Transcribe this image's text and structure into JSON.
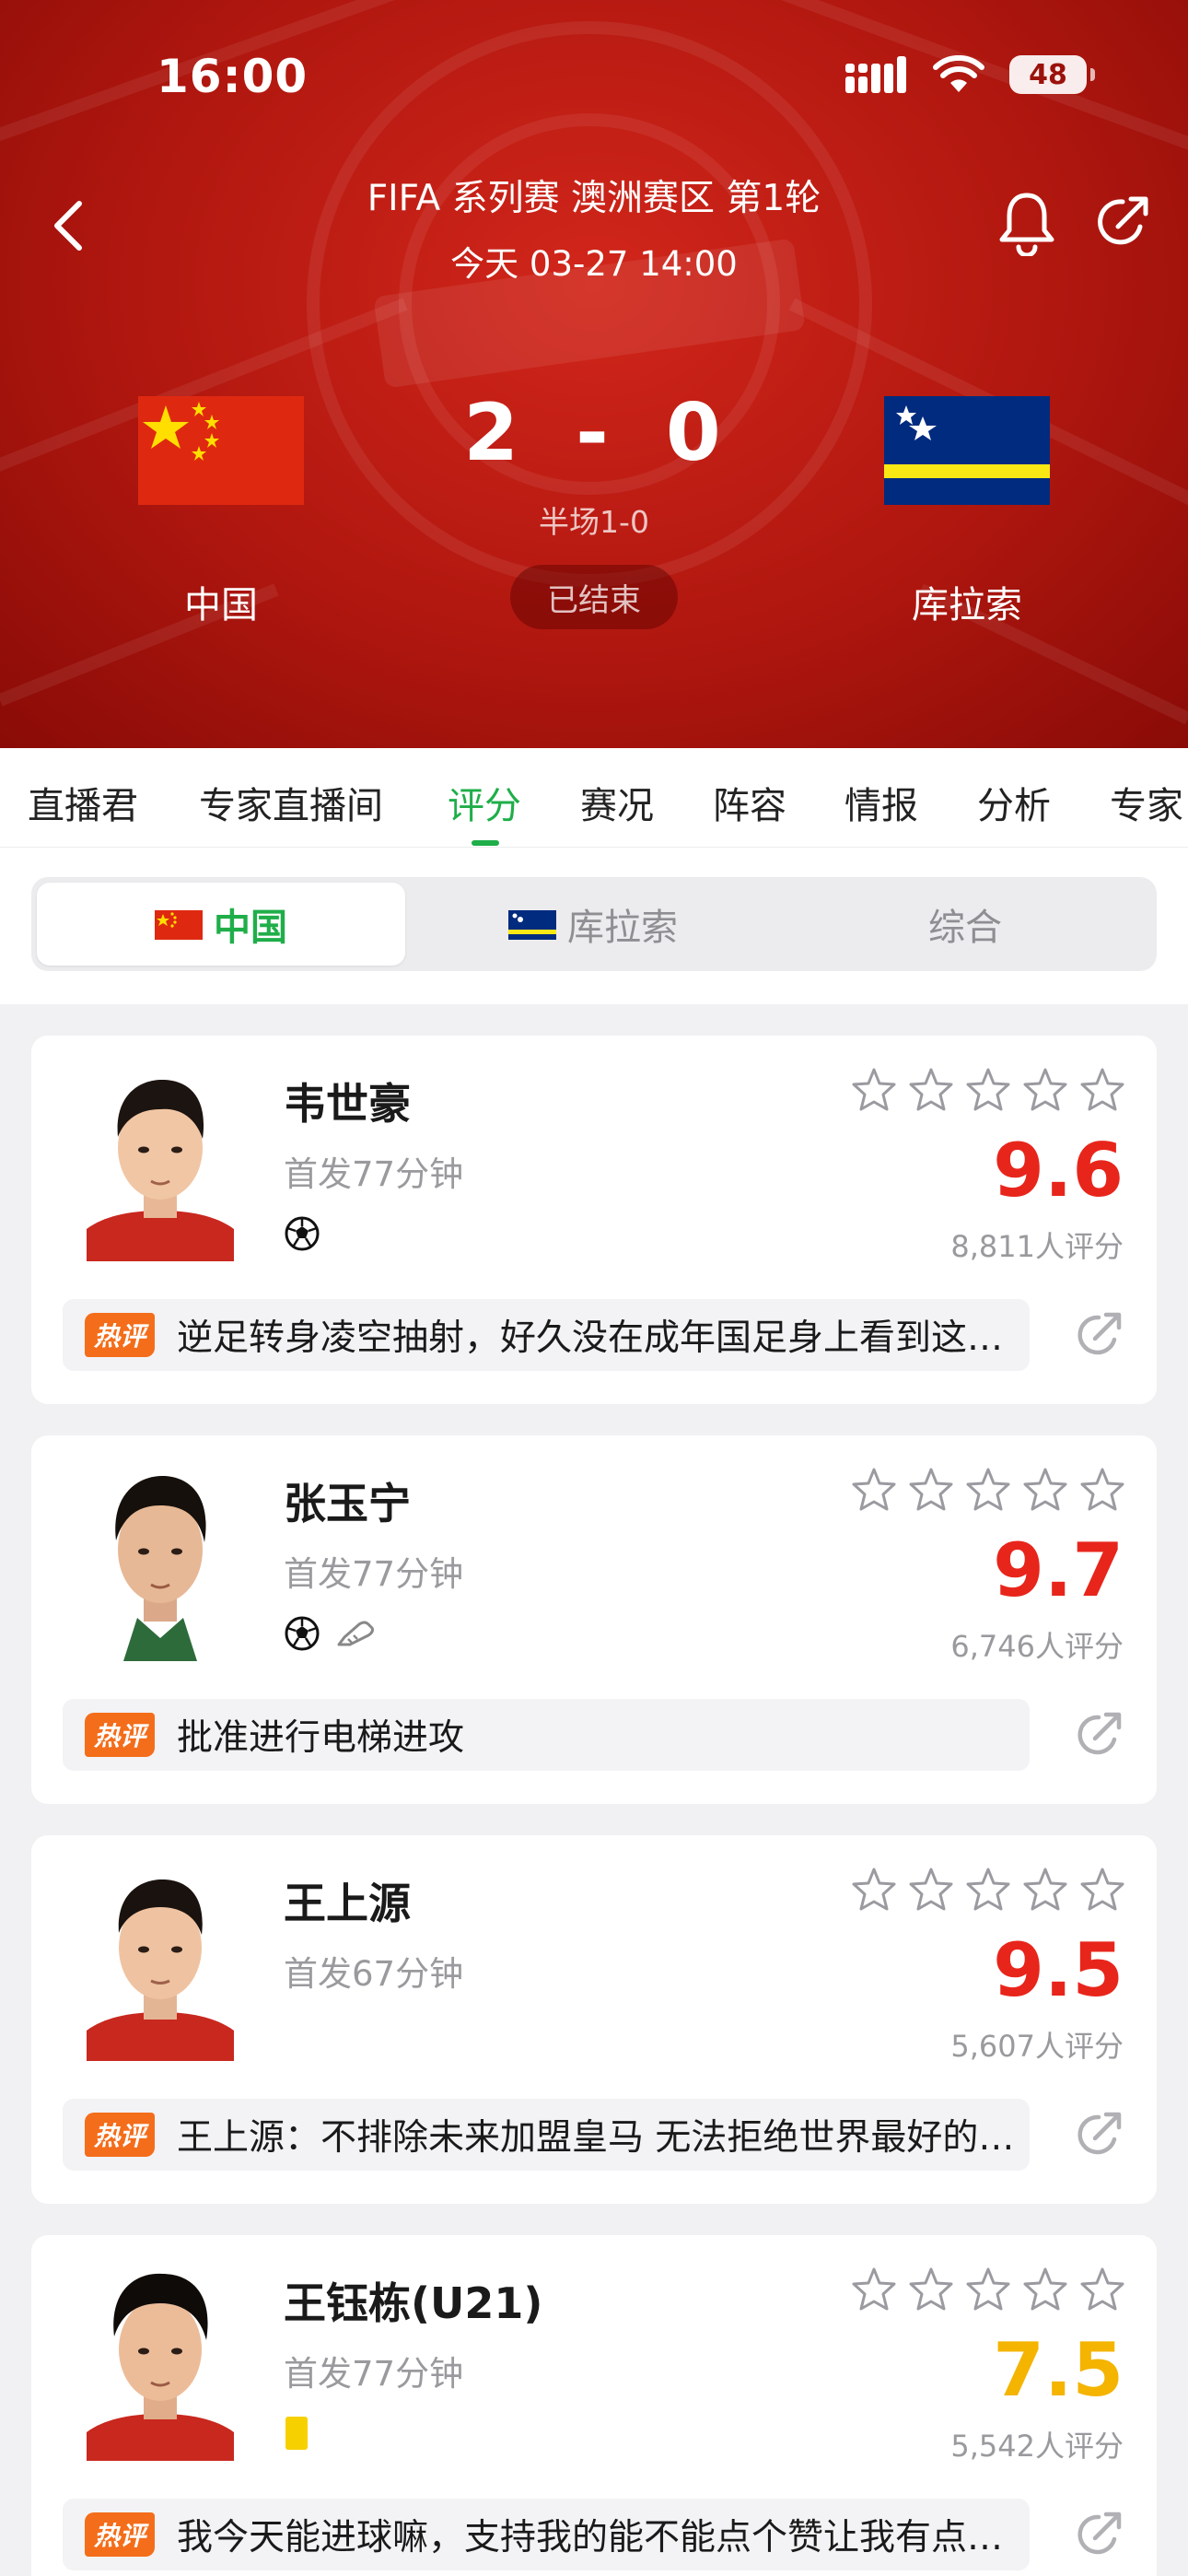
{
  "status_bar": {
    "time": "16:00",
    "battery": "48"
  },
  "match": {
    "title": "FIFA 系列赛 澳洲赛区 第1轮",
    "datetime": "今天 03-27 14:00",
    "home_team": "中国",
    "away_team": "库拉索",
    "home_score": "2",
    "away_score": "0",
    "separator": "-",
    "half_time": "半场1-0",
    "status": "已结束"
  },
  "tabs": [
    {
      "label": "直播君"
    },
    {
      "label": "专家直播间"
    },
    {
      "label": "评分",
      "active": true
    },
    {
      "label": "赛况"
    },
    {
      "label": "阵容"
    },
    {
      "label": "情报"
    },
    {
      "label": "分析"
    },
    {
      "label": "专家"
    }
  ],
  "segment": {
    "options": [
      {
        "label": "中国",
        "active": true
      },
      {
        "label": "库拉索"
      },
      {
        "label": "综合"
      }
    ]
  },
  "hot_label": "热评",
  "players": [
    {
      "name": "韦世豪",
      "minutes": "首发77分钟",
      "events": [
        "football-icon"
      ],
      "rating": "9.6",
      "rating_count": "8,811人评分",
      "hot_comment": "逆足转身凌空抽射，好久没在成年国足身上看到这种进球了"
    },
    {
      "name": "张玉宁",
      "minutes": "首发77分钟",
      "events": [
        "football-icon",
        "assist-boot-icon"
      ],
      "rating": "9.7",
      "rating_count": "6,746人评分",
      "hot_comment": "批准进行电梯进攻"
    },
    {
      "name": "王上源",
      "minutes": "首发67分钟",
      "events": [],
      "rating": "9.5",
      "rating_count": "5,607人评分",
      "hot_comment": "王上源：不排除未来加盟皇马 无法拒绝世界最好的俱乐部"
    },
    {
      "name": "王钰栋(U21)",
      "minutes": "首发77分钟",
      "events": [
        "yellow-card-icon"
      ],
      "rating": "7.5",
      "rating_color": "#f4b400",
      "rating_count": "5,542人评分",
      "hot_comment": "我今天能进球嘛，支持我的能不能点个赞让我有点信心"
    }
  ],
  "colors": {
    "accent_green": "#1fae49",
    "header_red": "#b0170f",
    "rating_red": "#e8251b",
    "rating_yellow": "#f4b400",
    "hot_orange": "#f46d1a"
  }
}
